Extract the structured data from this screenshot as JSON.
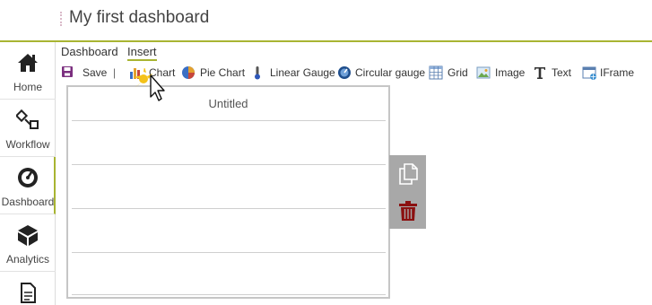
{
  "header": {
    "title": "My first dashboard"
  },
  "sidebar": {
    "items": [
      {
        "label": "Home",
        "icon": "home-icon"
      },
      {
        "label": "Workflow",
        "icon": "workflow-icon"
      },
      {
        "label": "Dashboard",
        "icon": "gauge-icon",
        "active": true
      },
      {
        "label": "Analytics",
        "icon": "cube-icon"
      },
      {
        "label": "",
        "icon": "document-icon"
      }
    ]
  },
  "menu": {
    "dashboard": "Dashboard",
    "insert": "Insert"
  },
  "toolbar": {
    "save": "Save",
    "separator": "|",
    "chart": "Chart",
    "pie_chart": "Pie Chart",
    "linear_gauge": "Linear Gauge",
    "circular_gauge": "Circular gauge",
    "grid": "Grid",
    "image": "Image",
    "text": "Text",
    "iframe": "IFrame"
  },
  "widget": {
    "title": "Untitled"
  },
  "colors": {
    "accent": "#a8b432",
    "save_icon": "#7b2f7f",
    "delete_icon": "#8b1010",
    "action_panel": "#a8a8a8"
  }
}
